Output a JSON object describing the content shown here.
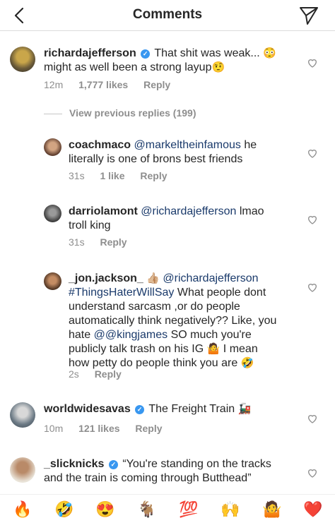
{
  "header": {
    "title": "Comments"
  },
  "main_comment": {
    "user": "richardajefferson",
    "text_line1": "That shit was weak...",
    "emoji1": "😳",
    "text_line2": "might as well been a strong layup",
    "emoji2": "🤨",
    "time": "12m",
    "likes": "1,777 likes",
    "reply": "Reply"
  },
  "view_previous": "View previous replies (199)",
  "replies": [
    {
      "user": "coachmaco",
      "mention": "@markeltheinfamous",
      "line1_tail": "he",
      "line2": "literally is one of brons best friends",
      "time": "31s",
      "likes": "1 like",
      "reply": "Reply"
    },
    {
      "user": "darriolamont",
      "mention": "@richardajefferson",
      "line1_tail": "lmao",
      "line2": "troll king",
      "time": "31s",
      "reply": "Reply"
    },
    {
      "user": "_jon.jackson_",
      "emoji_a": "👍🏼",
      "mention": "@richardajefferson",
      "hashtag": "#ThingsHaterWillSay",
      "line2_tail": "What people dont",
      "line3": "understand sarcasm ,or do people",
      "line4": "automatically think negatively?? Like, you",
      "line5_pre": "hate",
      "line5_mention": "@@kingjames",
      "line5_tail": "SO much you're",
      "line6_pre": "publicly talk trash on his IG",
      "emoji_b": "🤷",
      "line6_tail": "I mean",
      "line7": "how petty do people think you are",
      "emoji_c": "🤣",
      "time": "2s",
      "reply": "Reply"
    }
  ],
  "comment_worldwide": {
    "user": "worldwidesavas",
    "text": "The Freight Train",
    "emoji": "🚂",
    "time": "10m",
    "likes": "121 likes",
    "reply": "Reply"
  },
  "comment_slick": {
    "user": "_slicknicks",
    "line1": "“You're standing on the tracks",
    "line2": "and the train is coming through Butthead”"
  },
  "emoji_bar": [
    "🔥",
    "🤣",
    "😍",
    "🐐",
    "💯",
    "🙌",
    "🤷",
    "❤️"
  ],
  "colors": {
    "verified": "#3897f0",
    "meta": "#8e8e8e",
    "mention": "#1a3a6b"
  }
}
